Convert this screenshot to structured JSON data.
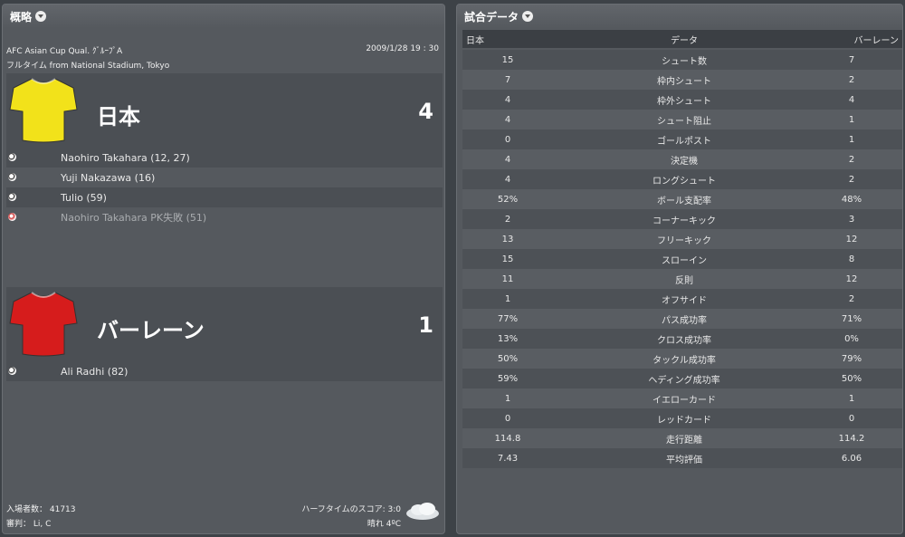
{
  "summary": {
    "title": "概略",
    "competition": "AFC Asian Cup Qual. ｸﾞﾙｰﾌﾟA",
    "datetime": "2009/1/28 19 : 30",
    "venue": "フルタイム from National Stadium, Tokyo",
    "home": {
      "name": "日本",
      "score": "4",
      "shirt_color": "#f2e21a",
      "goals": [
        {
          "text": "Naohiro Takahara (12, 27)",
          "type": "goal"
        },
        {
          "text": "Yuji Nakazawa (16)",
          "type": "goal"
        },
        {
          "text": "Tulio (59)",
          "type": "goal"
        },
        {
          "text": "Naohiro Takahara PK失敗 (51)",
          "type": "missed"
        }
      ]
    },
    "away": {
      "name": "バーレーン",
      "score": "1",
      "shirt_color": "#d61c1c",
      "goals": [
        {
          "text": "Ali Radhi (82)",
          "type": "goal"
        }
      ]
    },
    "footer": {
      "attendance": "入場者数： 41713",
      "referee": "審判： Li, C",
      "halftime": "ハーフタイムのスコア: 3:0",
      "weather": "晴れ 4ºC",
      "weather_icon": "cloud-icon"
    }
  },
  "stats": {
    "title": "試合データ",
    "headers": {
      "home": "日本",
      "label": "データ",
      "away": "バーレーン"
    },
    "rows": [
      {
        "home": "15",
        "label": "シュート数",
        "away": "7"
      },
      {
        "home": "7",
        "label": "枠内シュート",
        "away": "2"
      },
      {
        "home": "4",
        "label": "枠外シュート",
        "away": "4"
      },
      {
        "home": "4",
        "label": "シュート阻止",
        "away": "1"
      },
      {
        "home": "0",
        "label": "ゴールポスト",
        "away": "1"
      },
      {
        "home": "4",
        "label": "決定機",
        "away": "2"
      },
      {
        "home": "4",
        "label": "ロングシュート",
        "away": "2"
      },
      {
        "home": "52%",
        "label": "ボール支配率",
        "away": "48%"
      },
      {
        "home": "2",
        "label": "コーナーキック",
        "away": "3"
      },
      {
        "home": "13",
        "label": "フリーキック",
        "away": "12"
      },
      {
        "home": "15",
        "label": "スローイン",
        "away": "8"
      },
      {
        "home": "11",
        "label": "反則",
        "away": "12"
      },
      {
        "home": "1",
        "label": "オフサイド",
        "away": "2"
      },
      {
        "home": "77%",
        "label": "パス成功率",
        "away": "71%"
      },
      {
        "home": "13%",
        "label": "クロス成功率",
        "away": "0%"
      },
      {
        "home": "50%",
        "label": "タックル成功率",
        "away": "79%"
      },
      {
        "home": "59%",
        "label": "ヘディング成功率",
        "away": "50%"
      },
      {
        "home": "1",
        "label": "イエローカード",
        "away": "1"
      },
      {
        "home": "0",
        "label": "レッドカード",
        "away": "0"
      },
      {
        "home": "114.8",
        "label": "走行距離",
        "away": "114.2"
      },
      {
        "home": "7.43",
        "label": "平均評価",
        "away": "6.06"
      }
    ]
  }
}
